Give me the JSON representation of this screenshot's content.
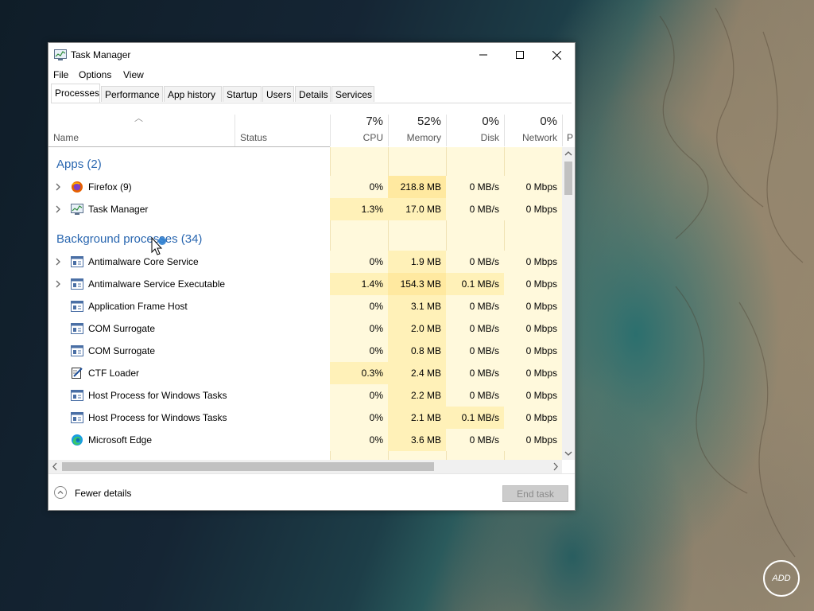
{
  "window": {
    "title": "Task Manager",
    "controls": {
      "minimize": "—",
      "maximize": "☐",
      "close": "✕"
    }
  },
  "menu": [
    "File",
    "Options",
    "View"
  ],
  "tabs": [
    "Processes",
    "Performance",
    "App history",
    "Startup",
    "Users",
    "Details",
    "Services"
  ],
  "active_tab": "Processes",
  "columns": {
    "name": "Name",
    "status": "Status",
    "cpu": {
      "pct": "7%",
      "label": "CPU"
    },
    "memory": {
      "pct": "52%",
      "label": "Memory"
    },
    "disk": {
      "pct": "0%",
      "label": "Disk"
    },
    "network": {
      "pct": "0%",
      "label": "Network"
    },
    "power": "P"
  },
  "groups": {
    "apps": "Apps (2)",
    "background": "Background processes (34)"
  },
  "rows": [
    {
      "name": "Firefox (9)",
      "cpu": "0%",
      "mem": "218.8 MB",
      "disk": "0 MB/s",
      "net": "0 Mbps",
      "icon": "firefox-icon"
    },
    {
      "name": "Task Manager",
      "cpu": "1.3%",
      "mem": "17.0 MB",
      "disk": "0 MB/s",
      "net": "0 Mbps",
      "icon": "task-manager-icon"
    },
    {
      "name": "Antimalware Core Service",
      "cpu": "0%",
      "mem": "1.9 MB",
      "disk": "0 MB/s",
      "net": "0 Mbps",
      "icon": "service-window-icon"
    },
    {
      "name": "Antimalware Service Executable",
      "cpu": "1.4%",
      "mem": "154.3 MB",
      "disk": "0.1 MB/s",
      "net": "0 Mbps",
      "icon": "service-window-icon"
    },
    {
      "name": "Application Frame Host",
      "cpu": "0%",
      "mem": "3.1 MB",
      "disk": "0 MB/s",
      "net": "0 Mbps",
      "icon": "service-window-icon"
    },
    {
      "name": "COM Surrogate",
      "cpu": "0%",
      "mem": "2.0 MB",
      "disk": "0 MB/s",
      "net": "0 Mbps",
      "icon": "service-window-icon"
    },
    {
      "name": "COM Surrogate",
      "cpu": "0%",
      "mem": "0.8 MB",
      "disk": "0 MB/s",
      "net": "0 Mbps",
      "icon": "service-window-icon"
    },
    {
      "name": "CTF Loader",
      "cpu": "0.3%",
      "mem": "2.4 MB",
      "disk": "0 MB/s",
      "net": "0 Mbps",
      "icon": "ctf-loader-icon"
    },
    {
      "name": "Host Process for Windows Tasks",
      "cpu": "0%",
      "mem": "2.2 MB",
      "disk": "0 MB/s",
      "net": "0 Mbps",
      "icon": "service-window-icon"
    },
    {
      "name": "Host Process for Windows Tasks",
      "cpu": "0%",
      "mem": "2.1 MB",
      "disk": "0.1 MB/s",
      "net": "0 Mbps",
      "icon": "service-window-icon"
    },
    {
      "name": "Microsoft Edge",
      "cpu": "0%",
      "mem": "3.6 MB",
      "disk": "0 MB/s",
      "net": "0 Mbps",
      "icon": "edge-icon"
    }
  ],
  "footer": {
    "fewer_details": "Fewer details",
    "end_task": "End task"
  },
  "desktop": {
    "badge": "ADD"
  },
  "colors": {
    "heat_light": "#fff9dc",
    "heat_mid": "#fff1b8",
    "heat_strong": "#ffe9a0",
    "group_title": "#2a67b0",
    "end_task_disabled": "#cccccc"
  }
}
